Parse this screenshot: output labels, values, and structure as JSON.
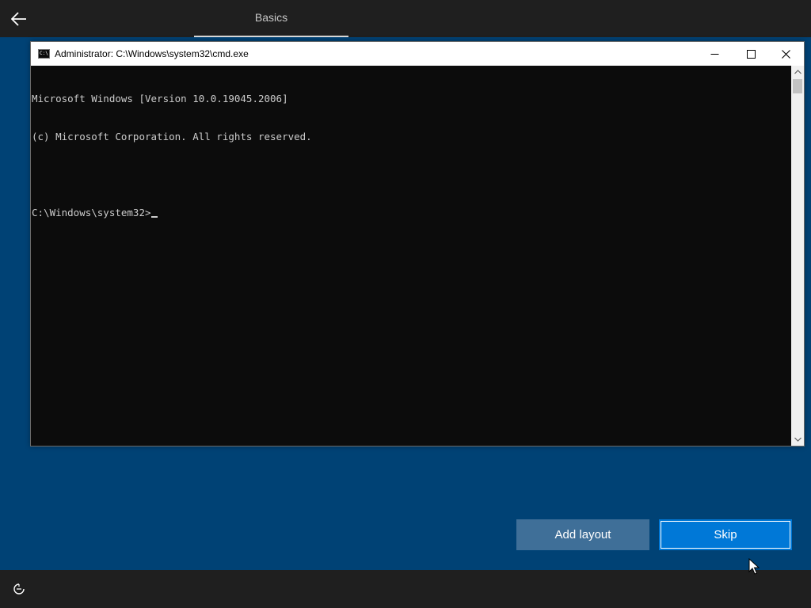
{
  "header": {
    "back_icon": "arrow-left-icon",
    "tab_label": "Basics"
  },
  "cmd_window": {
    "app_icon": "command-prompt-icon",
    "app_icon_text": "C:\\",
    "title": "Administrator: C:\\Windows\\system32\\cmd.exe",
    "controls": {
      "minimize_icon": "minimize-icon",
      "maximize_icon": "maximize-icon",
      "close_icon": "close-icon"
    },
    "lines": [
      "Microsoft Windows [Version 10.0.19045.2006]",
      "(c) Microsoft Corporation. All rights reserved.",
      "",
      "C:\\Windows\\system32>"
    ],
    "scrollbar": {
      "up_icon": "chevron-up-icon",
      "down_icon": "chevron-down-icon"
    }
  },
  "buttons": {
    "add_layout": "Add layout",
    "skip": "Skip"
  },
  "footer": {
    "accessibility_icon": "ease-of-access-icon"
  },
  "colors": {
    "background_blue": "#004275",
    "bar_dark": "#1f1f1f",
    "accent": "#0078d7",
    "secondary_button": "#3f6f98",
    "console_bg": "#0c0c0c",
    "console_text": "#cccccc"
  }
}
